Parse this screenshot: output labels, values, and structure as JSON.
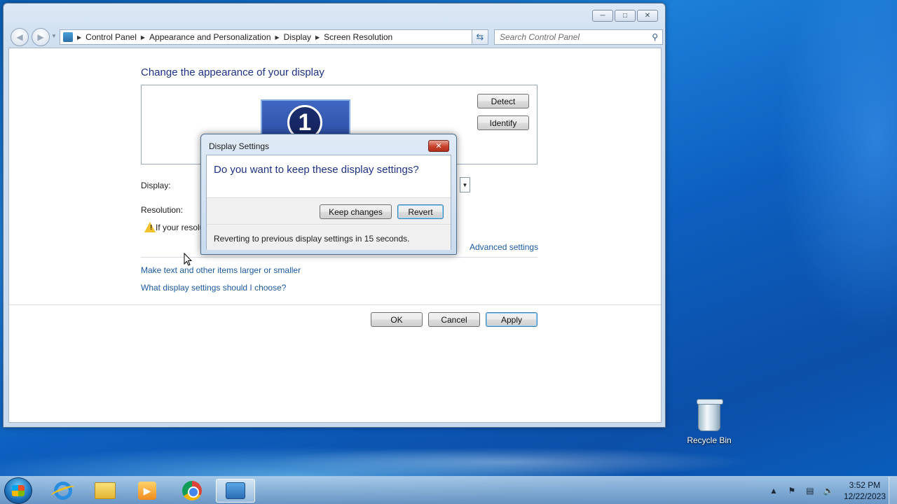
{
  "window": {
    "breadcrumb": [
      "Control Panel",
      "Appearance and Personalization",
      "Display",
      "Screen Resolution"
    ],
    "search_placeholder": "Search Control Panel"
  },
  "main": {
    "heading": "Change the appearance of your display",
    "monitor_number": "1",
    "detect_label": "Detect",
    "identify_label": "Identify",
    "display_label": "Display:",
    "resolution_label": "Resolution:",
    "warning_text": "If your resolu",
    "advanced_link": "Advanced settings",
    "link_text_size": "Make text and other items larger or smaller",
    "link_which_settings": "What display settings should I choose?",
    "ok_label": "OK",
    "cancel_label": "Cancel",
    "apply_label": "Apply"
  },
  "dialog": {
    "title": "Display Settings",
    "question": "Do you want to keep these display settings?",
    "keep_label": "Keep changes",
    "revert_label": "Revert",
    "countdown_text": "Reverting to previous display settings in 15 seconds."
  },
  "desktop": {
    "recycle_bin_label": "Recycle Bin"
  },
  "taskbar": {
    "pinned": [
      "internet-explorer",
      "windows-explorer",
      "media-player",
      "google-chrome",
      "control-panel"
    ],
    "active": "control-panel",
    "clock_time": "3:52 PM",
    "clock_date": "12/22/2023"
  },
  "colors": {
    "heading_blue": "#1e3287",
    "link_blue": "#1c5aa0",
    "desktop_blue": "#0a5fb8"
  }
}
